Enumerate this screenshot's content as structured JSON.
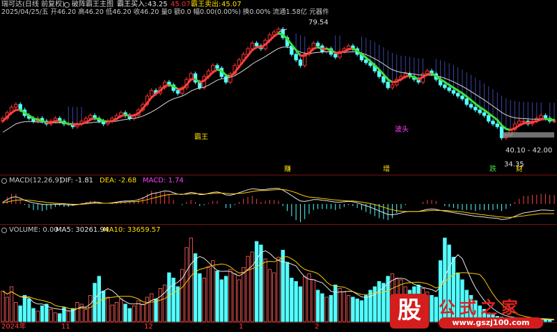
{
  "header": {
    "app_name": "瑞可达(日线 前复权)",
    "indicator_name": "破阵霸王主图",
    "buy_label": "霸王买入:",
    "buy_value1": "43.25",
    "buy_value2": "45.07",
    "sell_label": "霸王卖出:",
    "sell_value": "45.07",
    "info_line": "2025/04/25/五 开46.20 高46.20 低46.20 收46.20 量0 额0.0 幅0.00(0.00%) 换0.00% 流通1.58亿 元器件"
  },
  "main_annotations": {
    "high_price": "79.54",
    "low_price": "34.35",
    "range_label": "40.10 - 42.00",
    "wave_label": "霸王",
    "marker_top": "波头",
    "bottom_markers": [
      "赚",
      "增",
      "跌",
      "财"
    ]
  },
  "macd": {
    "title": "MACD(12,26,9)",
    "dif_label": "DIF: -1.81",
    "dea_label": "DEA: -2.68",
    "macd_label": "MACD: 1.74"
  },
  "volume": {
    "title": "VOLUME: 0.00",
    "ma5_label": "MA5: 30261.94",
    "ma10_label": "MA10: 33659.57"
  },
  "x_axis": {
    "labels": [
      "2024年",
      "11",
      "12",
      "1",
      "2"
    ]
  },
  "watermark": {
    "logo_char": "股",
    "site_name": "公式之家",
    "url": "www.gszj100.com"
  },
  "colors": {
    "up": "#ff3232",
    "down": "#54ffff",
    "ma_red": "#ff4040",
    "ma_green": "#3ce03c",
    "ma_white": "#d8d8d8",
    "yellow": "#ffcc00",
    "fill": "#4a5ad0"
  },
  "chart_data": [
    {
      "type": "candlestick",
      "title": "破阵霸王主图",
      "ylim": [
        30,
        84
      ],
      "annotated_high": 79.54,
      "annotated_low": 34.35,
      "range": [
        40.1,
        42.0
      ],
      "close": [
        47,
        49,
        51,
        52,
        50,
        48,
        47,
        46,
        47,
        46,
        45,
        46,
        47,
        46,
        45,
        45,
        44,
        45,
        46,
        47,
        48,
        47,
        46,
        45,
        46,
        47,
        48,
        49,
        48,
        47,
        48,
        50,
        52,
        55,
        57,
        56,
        58,
        60,
        59,
        57,
        56,
        58,
        61,
        63,
        60,
        58,
        62,
        64,
        66,
        65,
        62,
        60,
        63,
        66,
        68,
        70,
        72,
        74,
        73,
        72,
        75,
        77,
        78,
        79,
        76,
        73,
        70,
        68,
        66,
        70,
        72,
        74,
        73,
        71,
        72,
        70,
        69,
        71,
        72,
        73,
        72,
        70,
        68,
        67,
        66,
        64,
        62,
        60,
        58,
        59,
        61,
        62,
        63,
        62,
        61,
        60,
        63,
        64,
        63,
        61,
        59,
        58,
        57,
        56,
        55,
        54,
        52,
        51,
        50,
        49,
        48,
        46,
        45,
        44,
        40,
        41,
        43,
        45,
        46,
        46,
        45,
        46,
        47,
        48,
        47,
        46,
        46
      ],
      "ma_fast": [
        46,
        47.5,
        49,
        50,
        50,
        49,
        48,
        47,
        46.5,
        46,
        45.5,
        45.5,
        46,
        46,
        45.5,
        45,
        44.8,
        44.8,
        45,
        45.5,
        46.5,
        47,
        46.8,
        46,
        45.8,
        46,
        46.8,
        47.8,
        48.2,
        48,
        48,
        48.8,
        50.5,
        52.5,
        54.5,
        55.8,
        57,
        58.5,
        59,
        58.5,
        57.5,
        57.5,
        59,
        61,
        61,
        60,
        60.5,
        62,
        63.5,
        64.5,
        64,
        62.5,
        62,
        63.5,
        65.5,
        67.5,
        69.5,
        71.5,
        72.5,
        72.5,
        73.5,
        75,
        76.5,
        77.5,
        77,
        75.5,
        73.5,
        71.5,
        69.5,
        69.5,
        70.5,
        72,
        72.5,
        72,
        72,
        71.5,
        70.5,
        70.5,
        71,
        71.8,
        72,
        71.2,
        70,
        68.8,
        67.5,
        66,
        64.5,
        62.8,
        61,
        60,
        60.2,
        61,
        62,
        62.2,
        61.8,
        61,
        61.8,
        62.8,
        63,
        62.2,
        61,
        60,
        59,
        58,
        57,
        56,
        54.8,
        53.5,
        52.2,
        51,
        50,
        48.8,
        47.6,
        46.4,
        44.5,
        43.2,
        42.8,
        43.4,
        44.4,
        45.2,
        45.4,
        45.6,
        46,
        46.6,
        46.8,
        46.6,
        46.4
      ],
      "ma_slow": [
        42,
        43,
        44,
        45,
        45.5,
        45.8,
        45.8,
        45.8,
        45.7,
        45.6,
        45.5,
        45.4,
        45.4,
        45.4,
        45.3,
        45.2,
        45.1,
        45.1,
        45.1,
        45.2,
        45.4,
        45.6,
        45.7,
        45.7,
        45.7,
        45.8,
        46,
        46.3,
        46.6,
        46.8,
        47,
        47.3,
        47.8,
        48.5,
        49.3,
        50.2,
        51.2,
        52.3,
        53.3,
        54,
        54.5,
        55,
        55.8,
        56.8,
        57.5,
        57.8,
        58.2,
        58.9,
        59.8,
        60.7,
        61.2,
        61.4,
        61.7,
        62.3,
        63.2,
        64.2,
        65.3,
        66.5,
        67.5,
        68.3,
        69.2,
        70.2,
        71.2,
        72.1,
        72.6,
        72.6,
        72.2,
        71.6,
        70.8,
        70.4,
        70.3,
        70.5,
        70.7,
        70.8,
        70.9,
        70.9,
        70.8,
        70.7,
        70.7,
        70.8,
        70.9,
        70.8,
        70.4,
        69.9,
        69.2,
        68.4,
        67.5,
        66.5,
        65.4,
        64.5,
        63.9,
        63.5,
        63.3,
        63.1,
        62.9,
        62.6,
        62.5,
        62.5,
        62.5,
        62.3,
        61.9,
        61.4,
        60.8,
        60.1,
        59.3,
        58.5,
        57.6,
        56.6,
        55.6,
        54.6,
        53.6,
        52.5,
        51.4,
        50.3,
        49.1,
        48.2,
        47.6,
        47.2,
        47,
        46.9,
        46.8,
        46.7,
        46.7,
        46.7,
        46.7,
        46.7,
        46.6
      ]
    },
    {
      "type": "line",
      "title": "MACD(12,26,9)",
      "ylim": [
        -5,
        5
      ],
      "series": [
        {
          "name": "DIF",
          "values": [
            0.5,
            1.2,
            1.8,
            2.0,
            1.6,
            1.0,
            0.6,
            0.3,
            0.1,
            -0.1,
            -0.2,
            -0.2,
            -0.1,
            -0.1,
            -0.2,
            -0.3,
            -0.3,
            -0.2,
            0,
            0.2,
            0.4,
            0.5,
            0.4,
            0.2,
            0.2,
            0.3,
            0.5,
            0.7,
            0.8,
            0.8,
            0.9,
            1.2,
            1.6,
            2.2,
            2.8,
            3.0,
            3.3,
            3.6,
            3.5,
            3.1,
            2.7,
            2.6,
            2.9,
            3.2,
            3.0,
            2.6,
            2.6,
            2.9,
            3.2,
            3.3,
            3.0,
            2.5,
            2.4,
            2.7,
            3.1,
            3.5,
            3.9,
            4.2,
            4.1,
            3.9,
            4.0,
            4.2,
            4.3,
            4.3,
            3.8,
            3.1,
            2.3,
            1.5,
            0.8,
            0.7,
            0.9,
            1.2,
            1.2,
            1.0,
            0.9,
            0.7,
            0.5,
            0.5,
            0.6,
            0.7,
            0.6,
            0.3,
            -0.1,
            -0.5,
            -0.9,
            -1.4,
            -1.9,
            -2.4,
            -2.9,
            -3.0,
            -2.8,
            -2.5,
            -2.2,
            -2.1,
            -2.1,
            -2.1,
            -1.8,
            -1.5,
            -1.4,
            -1.5,
            -1.8,
            -2.0,
            -2.2,
            -2.4,
            -2.6,
            -2.8,
            -3.0,
            -3.2,
            -3.4,
            -3.5,
            -3.6,
            -3.8,
            -3.9,
            -4.0,
            -4.3,
            -4.2,
            -3.9,
            -3.4,
            -2.9,
            -2.5,
            -2.3,
            -2.1,
            -1.9,
            -1.7,
            -1.7,
            -1.8,
            -1.81
          ]
        },
        {
          "name": "DEA",
          "values": [
            0.3,
            0.5,
            0.8,
            1.0,
            1.1,
            1.1,
            1.0,
            0.9,
            0.7,
            0.6,
            0.4,
            0.3,
            0.2,
            0.1,
            0.1,
            0,
            -0.1,
            -0.1,
            -0.1,
            0,
            0.1,
            0.2,
            0.2,
            0.2,
            0.2,
            0.2,
            0.3,
            0.4,
            0.5,
            0.6,
            0.6,
            0.7,
            0.9,
            1.2,
            1.5,
            1.8,
            2.1,
            2.4,
            2.6,
            2.7,
            2.7,
            2.7,
            2.7,
            2.8,
            2.8,
            2.8,
            2.7,
            2.8,
            2.9,
            3.0,
            3.0,
            2.9,
            2.8,
            2.8,
            2.9,
            3.0,
            3.2,
            3.4,
            3.6,
            3.7,
            3.7,
            3.8,
            3.9,
            4.0,
            4.0,
            3.8,
            3.5,
            3.1,
            2.6,
            2.2,
            1.9,
            1.8,
            1.7,
            1.5,
            1.4,
            1.2,
            1.1,
            1.0,
            0.9,
            0.8,
            0.8,
            0.7,
            0.5,
            0.3,
            0.1,
            -0.2,
            -0.5,
            -0.9,
            -1.3,
            -1.6,
            -1.9,
            -2.0,
            -2.1,
            -2.1,
            -2.1,
            -2.1,
            -2.0,
            -1.9,
            -1.8,
            -1.8,
            -1.8,
            -1.8,
            -1.9,
            -2.0,
            -2.1,
            -2.2,
            -2.4,
            -2.6,
            -2.7,
            -2.9,
            -3.0,
            -3.2,
            -3.3,
            -3.5,
            -3.6,
            -3.7,
            -3.7,
            -3.6,
            -3.4,
            -3.3,
            -3.1,
            -3.0,
            -2.8,
            -2.7,
            -2.7,
            -2.7,
            -2.68
          ]
        }
      ],
      "macd_last": 1.74
    },
    {
      "type": "bar",
      "title": "VOLUME",
      "ylim": [
        0,
        100000
      ],
      "values": [
        35000,
        28000,
        40000,
        22000,
        18000,
        30000,
        26000,
        15000,
        12000,
        18000,
        20000,
        14000,
        10000,
        9000,
        16000,
        12000,
        15000,
        22000,
        20000,
        14000,
        30000,
        44000,
        52000,
        35000,
        28000,
        19000,
        22000,
        26000,
        20000,
        15000,
        18000,
        24000,
        20000,
        28000,
        32000,
        26000,
        38000,
        42000,
        56000,
        50000,
        40000,
        60000,
        85000,
        96000,
        78000,
        55000,
        50000,
        62000,
        70000,
        58000,
        48000,
        52000,
        60000,
        55000,
        48000,
        62000,
        75000,
        80000,
        92000,
        88000,
        72000,
        60000,
        56000,
        74000,
        82000,
        68000,
        50000,
        46000,
        40000,
        52000,
        55000,
        48000,
        36000,
        32000,
        28000,
        30000,
        42000,
        38000,
        34000,
        30000,
        28000,
        26000,
        24000,
        30000,
        36000,
        40000,
        46000,
        44000,
        52000,
        55000,
        50000,
        48000,
        40000,
        36000,
        40000,
        42000,
        38000,
        34000,
        30000,
        28000,
        70000,
        96000,
        88000,
        74000,
        56000,
        48000,
        36000,
        30000,
        24000,
        18000,
        14000,
        10000,
        8000,
        6000,
        5000,
        4500,
        4000,
        4000,
        4000,
        3500,
        3000,
        2800,
        2500,
        2200,
        2000,
        1800,
        0
      ],
      "ma5": 30261.94,
      "ma10": 33659.57
    }
  ]
}
